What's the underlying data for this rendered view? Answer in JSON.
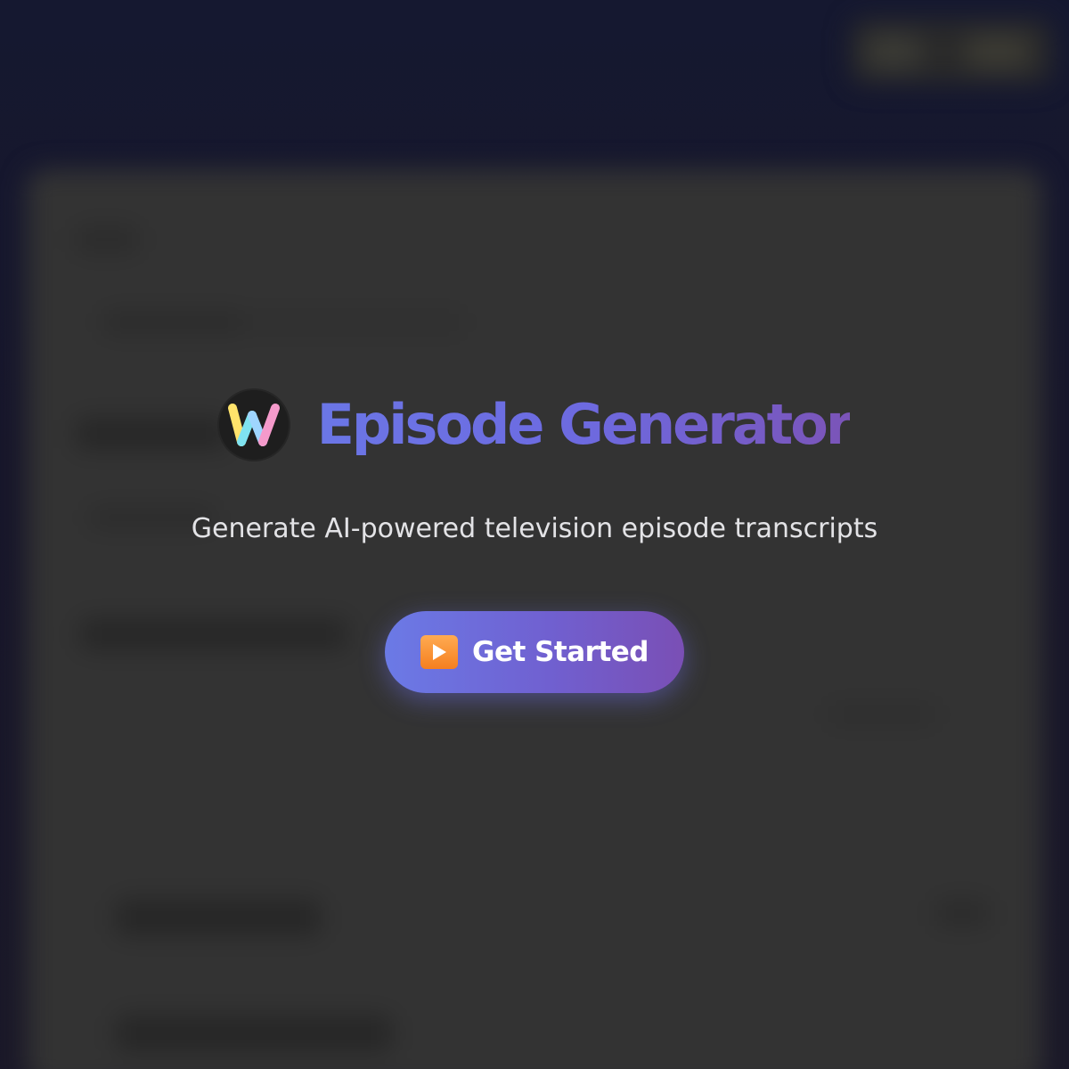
{
  "app": {
    "title": "Episode Generator",
    "tagline": "Generate AI-powered television episode transcripts",
    "logo_icon": "w-logo-icon"
  },
  "cta": {
    "label": "Get Started",
    "icon": "play-button-icon"
  },
  "colors": {
    "accent_start": "#6b7ae6",
    "accent_end": "#7a4fb5",
    "panel_bg": "#333333",
    "page_bg": "#151830",
    "play_icon": "#f57f1f"
  }
}
